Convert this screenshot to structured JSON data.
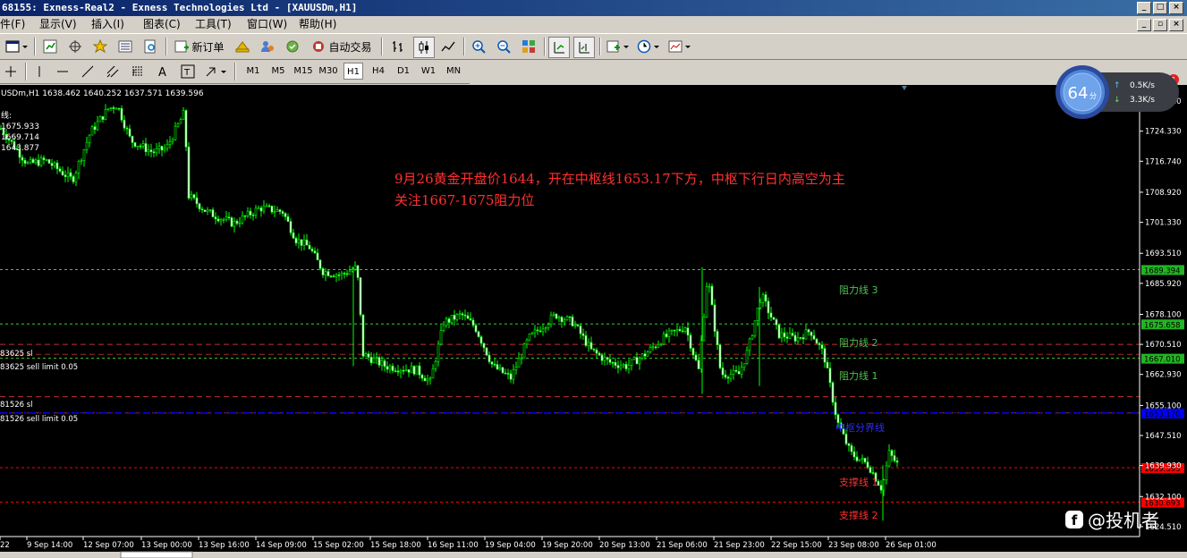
{
  "window": {
    "title": "68155: Exness-Real2 - Exness Technologies Ltd - [XAUUSDm,H1]"
  },
  "menu": [
    "件(F)",
    "显示(V)",
    "插入(I)",
    "图表(C)",
    "工具(T)",
    "窗口(W)",
    "帮助(H)"
  ],
  "toolbar": {
    "new_order": "新订单",
    "auto_trade": "自动交易"
  },
  "timeframes": [
    "M1",
    "M5",
    "M15",
    "M30",
    "H1",
    "H4",
    "D1",
    "W1",
    "MN"
  ],
  "active_timeframe": "H1",
  "notification_count": "1",
  "chart_header": "USDm,H1  1638.462 1640.252 1637.571 1639.596",
  "indicator_values": [
    "1675.933",
    "1669.714",
    "1643.877"
  ],
  "order_labels": [
    "83625 sl",
    "83625 sell limit 0.05",
    "81526 sl",
    "81526 sell limit 0.05"
  ],
  "annotation": {
    "line1": "9月26黄金开盘价1644，开在中枢线1653.17下方，中枢下行日内高空为主",
    "line2": "关注1667-1675阻力位"
  },
  "level_names": [
    "阻力线 3",
    "阻力线 2",
    "阻力线 1",
    "中枢分界线",
    "支撑线 1",
    "支撑线 2"
  ],
  "widget": {
    "score": "64",
    "score_unit": "分",
    "upload": "0.5K/s",
    "download": "3.3K/s"
  },
  "watermark": "@投机者",
  "colors": {
    "candles": "#00ff00",
    "resistance": "#7cfc00",
    "pivot": "#0000ff",
    "support": "#ff0000",
    "annotation": "#ff3030"
  },
  "chart_data": {
    "type": "candlestick",
    "symbol": "XAUUSDm",
    "timeframe": "H1",
    "y_ticks": [
      1731.92,
      1724.33,
      1716.74,
      1708.92,
      1701.33,
      1693.51,
      1685.92,
      1678.1,
      1670.51,
      1662.93,
      1655.1,
      1647.51,
      1639.93,
      1632.1,
      1624.51
    ],
    "ylim": [
      1622,
      1736
    ],
    "x_ticks": [
      "22",
      "9 Sep 14:00",
      "12 Sep 07:00",
      "13 Sep 00:00",
      "13 Sep 16:00",
      "14 Sep 09:00",
      "15 Sep 02:00",
      "15 Sep 18:00",
      "16 Sep 11:00",
      "19 Sep 04:00",
      "19 Sep 20:00",
      "20 Sep 13:00",
      "21 Sep 06:00",
      "21 Sep 23:00",
      "22 Sep 15:00",
      "23 Sep 08:00",
      "26 Sep 01:00"
    ],
    "levels": [
      {
        "name": "阻力线 3",
        "value": 1689.394,
        "color": "#32cd32"
      },
      {
        "name": "阻力线 2",
        "value": 1675.658,
        "color": "#32cd32"
      },
      {
        "name": "阻力线 1",
        "value": 1667.01,
        "color": "#32cd32"
      },
      {
        "name": "中枢分界线",
        "value": 1653.17,
        "color": "#0000ff"
      },
      {
        "name": "支撑线 1",
        "value": 1639.393,
        "color": "#ff0000"
      },
      {
        "name": "支撑线 2",
        "value": 1630.693,
        "color": "#ff0000"
      }
    ],
    "order_levels": [
      1670.5,
      1668.0,
      1657.3,
      1653.2
    ],
    "close_path": [
      [
        0,
        1725
      ],
      [
        30,
        1716
      ],
      [
        50,
        1717
      ],
      [
        80,
        1712
      ],
      [
        100,
        1724
      ],
      [
        120,
        1730
      ],
      [
        130,
        1731
      ],
      [
        145,
        1722
      ],
      [
        170,
        1719
      ],
      [
        185,
        1720
      ],
      [
        205,
        1729
      ],
      [
        210,
        1708
      ],
      [
        230,
        1704
      ],
      [
        260,
        1701
      ],
      [
        290,
        1705
      ],
      [
        315,
        1704
      ],
      [
        330,
        1697
      ],
      [
        345,
        1695
      ],
      [
        360,
        1689
      ],
      [
        380,
        1688
      ],
      [
        398,
        1690
      ],
      [
        405,
        1668
      ],
      [
        430,
        1665
      ],
      [
        465,
        1664
      ],
      [
        480,
        1661
      ],
      [
        495,
        1676
      ],
      [
        515,
        1678
      ],
      [
        530,
        1675
      ],
      [
        550,
        1665
      ],
      [
        570,
        1662
      ],
      [
        590,
        1672
      ],
      [
        620,
        1678
      ],
      [
        640,
        1676
      ],
      [
        660,
        1669
      ],
      [
        680,
        1666
      ],
      [
        700,
        1665
      ],
      [
        720,
        1668
      ],
      [
        740,
        1672
      ],
      [
        765,
        1675
      ],
      [
        780,
        1664
      ],
      [
        790,
        1688
      ],
      [
        805,
        1663
      ],
      [
        825,
        1663
      ],
      [
        835,
        1669
      ],
      [
        850,
        1683
      ],
      [
        870,
        1673
      ],
      [
        890,
        1672
      ],
      [
        905,
        1674
      ],
      [
        920,
        1668
      ],
      [
        935,
        1651
      ],
      [
        950,
        1643
      ],
      [
        970,
        1640
      ],
      [
        985,
        1634
      ],
      [
        993,
        1643
      ],
      [
        1003,
        1640
      ]
    ]
  }
}
